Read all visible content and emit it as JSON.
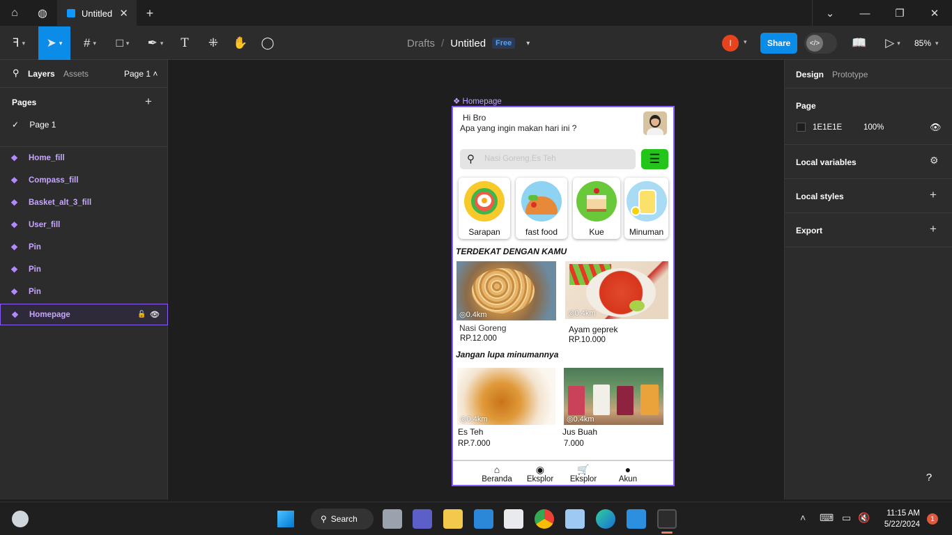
{
  "browser": {
    "tab_title": "Untitled",
    "close_glyph": "✕",
    "new_tab_glyph": "+"
  },
  "toolbar": {
    "breadcrumb_drafts": "Drafts",
    "breadcrumb_sep": "/",
    "file_title": "Untitled",
    "plan_badge": "Free",
    "user_initial": "I",
    "share_label": "Share",
    "zoom_label": "85%"
  },
  "left_panel": {
    "tab_layers": "Layers",
    "tab_assets": "Assets",
    "page_selector": "Page 1 ˄",
    "pages_heading": "Pages",
    "pages": [
      {
        "label": "Page 1",
        "selected": true
      }
    ],
    "layers": [
      {
        "label": "Home_fill"
      },
      {
        "label": "Compass_fill"
      },
      {
        "label": "Basket_alt_3_fill"
      },
      {
        "label": "User_fill"
      },
      {
        "label": "Pin"
      },
      {
        "label": "Pin"
      },
      {
        "label": "Pin"
      },
      {
        "label": "Homepage",
        "selected": true
      }
    ]
  },
  "right_panel": {
    "tab_design": "Design",
    "tab_prototype": "Prototype",
    "page_heading": "Page",
    "page_color": "1E1E1E",
    "page_opacity": "100%",
    "local_variables": "Local variables",
    "local_styles": "Local styles",
    "export": "Export"
  },
  "canvas": {
    "frame_label": "Homepage",
    "app": {
      "greeting": "Hi Bro",
      "question": "Apa yang ingin makan hari ini ?",
      "search_placeholder": "Nasi Goreng,Es Teh",
      "categories": [
        {
          "label": "Sarapan",
          "color": "#f7c92b"
        },
        {
          "label": "fast food",
          "color": "#8fd3f2"
        },
        {
          "label": "Kue",
          "color": "#69c93a"
        },
        {
          "label": "Minuman",
          "color": "#a9dcf4"
        }
      ],
      "section_nearby": "TERDEKAT DENGAN KAMU",
      "foods": [
        {
          "name": "Nasi Goreng",
          "price": "RP.12.000",
          "distance": "0.4km"
        },
        {
          "name": "Ayam geprek",
          "price": "RP.10.000",
          "distance": "0.4km"
        }
      ],
      "section_drinks": "Jangan lupa minumannya",
      "drinks": [
        {
          "name": "Es Teh",
          "price": "RP.7.000",
          "distance": "0.4km"
        },
        {
          "name": "Jus Buah",
          "price": "7.000",
          "distance": "0.4km"
        }
      ],
      "nav": [
        {
          "label": "Beranda",
          "icon": "home-icon"
        },
        {
          "label": "Eksplor",
          "icon": "compass-icon"
        },
        {
          "label": "Eksplor",
          "icon": "basket-icon"
        },
        {
          "label": "Akun",
          "icon": "user-icon"
        }
      ]
    }
  },
  "taskbar": {
    "search_label": "Search",
    "time": "11:15 AM",
    "date": "5/22/2024",
    "notification_count": "1"
  },
  "help_label": "?"
}
